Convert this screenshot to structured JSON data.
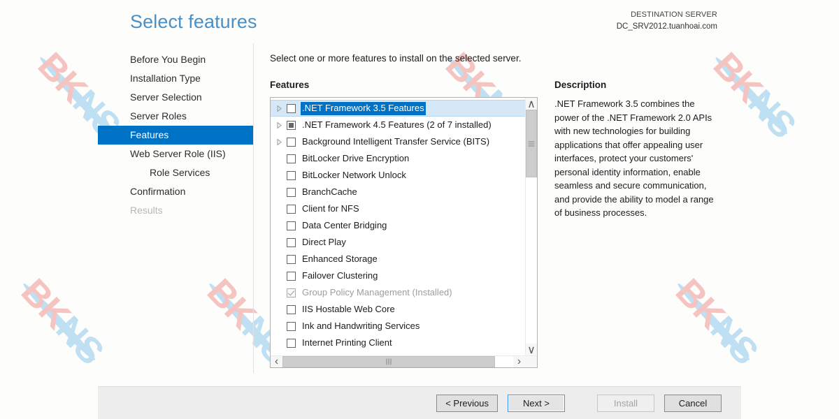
{
  "header": {
    "title": "Select features",
    "destination_label": "DESTINATION SERVER",
    "destination_server": "DC_SRV2012.tuanhoai.com"
  },
  "sidebar": {
    "items": [
      {
        "label": "Before You Begin",
        "state": "normal",
        "sub": false
      },
      {
        "label": "Installation Type",
        "state": "normal",
        "sub": false
      },
      {
        "label": "Server Selection",
        "state": "normal",
        "sub": false
      },
      {
        "label": "Server Roles",
        "state": "normal",
        "sub": false
      },
      {
        "label": "Features",
        "state": "active",
        "sub": false
      },
      {
        "label": "Web Server Role (IIS)",
        "state": "normal",
        "sub": false
      },
      {
        "label": "Role Services",
        "state": "normal",
        "sub": true
      },
      {
        "label": "Confirmation",
        "state": "normal",
        "sub": false
      },
      {
        "label": "Results",
        "state": "disabled",
        "sub": false
      }
    ]
  },
  "main": {
    "instruction": "Select one or more features to install on the selected server.",
    "features_heading": "Features",
    "description_heading": "Description",
    "description_text": ".NET Framework 3.5 combines the power of the .NET Framework 2.0 APIs with new technologies for building applications that offer appealing user interfaces, protect your customers' personal identity information, enable seamless and secure communication, and provide the ability to model a range of business processes.",
    "features": [
      {
        "label": ".NET Framework 3.5 Features",
        "checkbox": "unchecked",
        "expandable": true,
        "selected": true,
        "installed": false
      },
      {
        "label": ".NET Framework 4.5 Features (2 of 7 installed)",
        "checkbox": "partial",
        "expandable": true,
        "selected": false,
        "installed": false
      },
      {
        "label": "Background Intelligent Transfer Service (BITS)",
        "checkbox": "unchecked",
        "expandable": true,
        "selected": false,
        "installed": false
      },
      {
        "label": "BitLocker Drive Encryption",
        "checkbox": "unchecked",
        "expandable": false,
        "selected": false,
        "installed": false
      },
      {
        "label": "BitLocker Network Unlock",
        "checkbox": "unchecked",
        "expandable": false,
        "selected": false,
        "installed": false
      },
      {
        "label": "BranchCache",
        "checkbox": "unchecked",
        "expandable": false,
        "selected": false,
        "installed": false
      },
      {
        "label": "Client for NFS",
        "checkbox": "unchecked",
        "expandable": false,
        "selected": false,
        "installed": false
      },
      {
        "label": "Data Center Bridging",
        "checkbox": "unchecked",
        "expandable": false,
        "selected": false,
        "installed": false
      },
      {
        "label": "Direct Play",
        "checkbox": "unchecked",
        "expandable": false,
        "selected": false,
        "installed": false
      },
      {
        "label": "Enhanced Storage",
        "checkbox": "unchecked",
        "expandable": false,
        "selected": false,
        "installed": false
      },
      {
        "label": "Failover Clustering",
        "checkbox": "unchecked",
        "expandable": false,
        "selected": false,
        "installed": false
      },
      {
        "label": "Group Policy Management (Installed)",
        "checkbox": "checked-disabled",
        "expandable": false,
        "selected": false,
        "installed": true
      },
      {
        "label": "IIS Hostable Web Core",
        "checkbox": "unchecked",
        "expandable": false,
        "selected": false,
        "installed": false
      },
      {
        "label": "Ink and Handwriting Services",
        "checkbox": "unchecked",
        "expandable": false,
        "selected": false,
        "installed": false
      },
      {
        "label": "Internet Printing Client",
        "checkbox": "unchecked",
        "expandable": false,
        "selected": false,
        "installed": false
      }
    ]
  },
  "scrollbars": {
    "vertical_up_glyph": "∧",
    "vertical_down_glyph": "∨",
    "horizontal_left_glyph": "‹",
    "horizontal_right_glyph": "›"
  },
  "footer": {
    "buttons": [
      {
        "label": "< Previous",
        "state": "normal"
      },
      {
        "label": "Next >",
        "state": "focused"
      },
      {
        "label": "Install",
        "state": "disabled"
      },
      {
        "label": "Cancel",
        "state": "normal"
      }
    ]
  },
  "watermark": {
    "text_primary": "BK",
    "text_secondary": "NS"
  },
  "colors": {
    "accent_blue": "#0072c6",
    "title_blue": "#4a90c4",
    "selection_band": "#d6e7f7",
    "footer_bg": "#ededed",
    "watermark_pink": "#f6c4c0",
    "watermark_blue": "#bfe0f2"
  }
}
